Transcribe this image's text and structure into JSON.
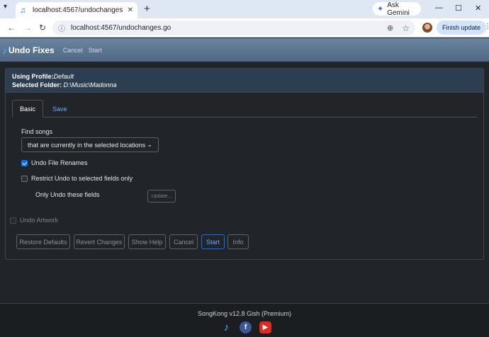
{
  "browser": {
    "tab_title": "localhost:4567/undochanges.go",
    "tab_close": "✕",
    "new_tab": "+",
    "ask_gemini": "Ask Gemini",
    "url": "localhost:4567/undochanges.go",
    "finish_update": "Finish update",
    "min": "—",
    "max": "☐",
    "close": "✕"
  },
  "app": {
    "brand": "Undo Fixes",
    "menu": [
      "Cancel",
      "Start"
    ]
  },
  "panel": {
    "profile_label": "Using Profile:",
    "profile_value": "Default",
    "folder_label": "Selected Folder: ",
    "folder_value": "D:\\Music\\Madonna"
  },
  "tabs": [
    "Basic",
    "Save"
  ],
  "form": {
    "find_songs_label": "Find songs",
    "find_songs_value": "that are currently in the selected locations",
    "undo_renames": "Undo File Renames",
    "undo_renames_checked": true,
    "restrict_undo": "Restrict Undo to selected fields only",
    "restrict_undo_checked": false,
    "only_fields": "Only Undo these fields",
    "update_btn": "Update...",
    "undo_artwork": "Undo Artwork",
    "undo_artwork_checked": false
  },
  "buttons": [
    "Restore Defaults",
    "Revert Changes",
    "Show Help",
    "Cancel",
    "Start",
    "Info"
  ],
  "footer": {
    "version": "SongKong v12.8 Gish (Premium)"
  },
  "colors": {
    "accent": "#0d6efd",
    "header": "#2c3e50",
    "background": "#212529"
  }
}
